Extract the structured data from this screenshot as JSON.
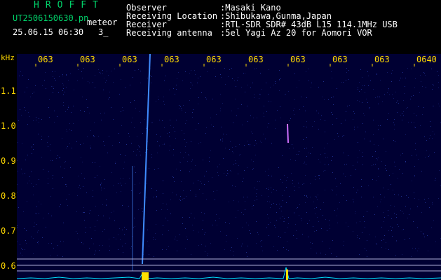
{
  "header": {
    "title": "HROFFT",
    "filename": "UT2506150630.pn",
    "filename_suffix": "meteor",
    "datetime": "25.06.15 06:30",
    "count": "3_"
  },
  "metadata": [
    {
      "label": "Observer",
      "value": ":Masaki Kano"
    },
    {
      "label": "Receiving Location",
      "value": ":Shibukawa,Gunma,Japan"
    },
    {
      "label": "Receiver",
      "value": ":RTL-SDR SDR# 43dB L15 114.1MHz USB"
    },
    {
      "label": "Receiving antenna",
      "value": ":5el Yagi Az 20 for Aomori VOR"
    }
  ],
  "time_ticks": [
    "063",
    "063",
    "063",
    "063",
    "063",
    "063",
    "063",
    "063",
    "063",
    "0640"
  ],
  "y_axis": {
    "unit": "kHz",
    "labels": [
      "1.1",
      "1.0",
      "0.9",
      "0.8",
      "0.7",
      "0.6"
    ]
  },
  "colors": {
    "text": "#ffffff",
    "title": "#00d26a",
    "axis": "#ffd800",
    "background": "#000033",
    "signal": "#4b9dff",
    "baseline": "#00e0ff"
  }
}
